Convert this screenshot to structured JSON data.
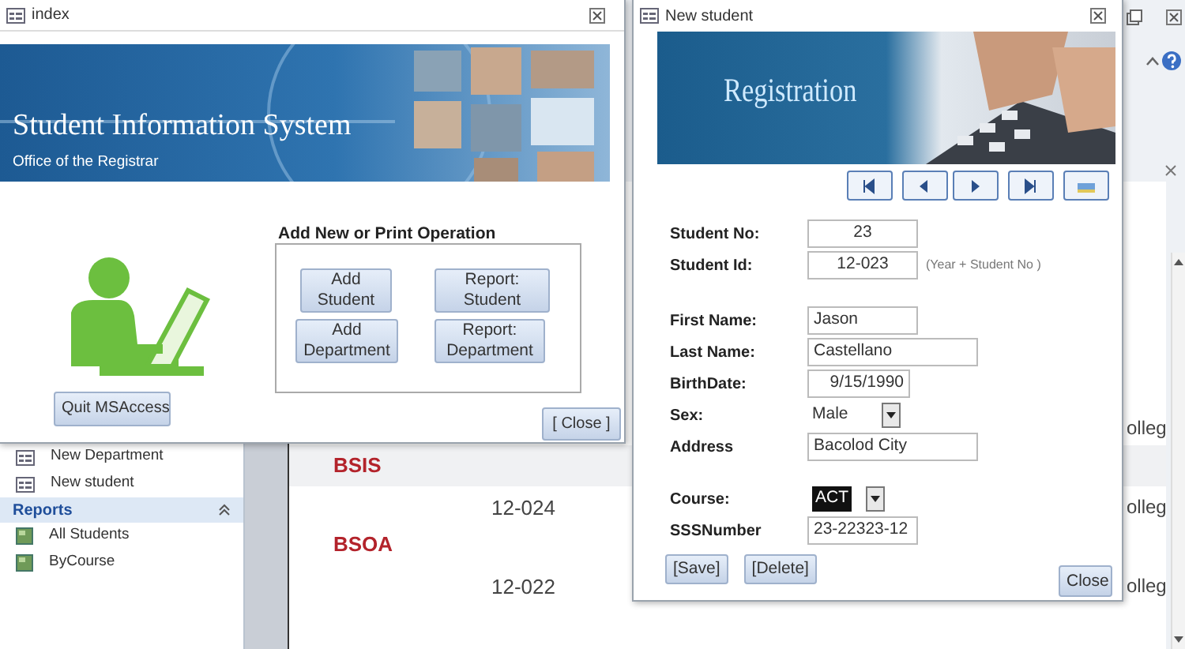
{
  "access": {
    "nav_items": [
      {
        "label": "New Department",
        "kind": "form"
      },
      {
        "label": "New student",
        "kind": "form"
      }
    ],
    "nav_group": {
      "label": "Reports",
      "expanded": true
    },
    "report_items": [
      {
        "label": "All Students",
        "kind": "report"
      },
      {
        "label": "ByCourse",
        "kind": "report"
      }
    ],
    "report_rows": [
      {
        "kind": "record",
        "college": "olleg"
      },
      {
        "kind": "group",
        "text": "BSIS"
      },
      {
        "kind": "record",
        "id": "12-024",
        "college": "olleg"
      },
      {
        "kind": "group",
        "text": "BSOA"
      },
      {
        "kind": "record",
        "id": "12-022",
        "college": "olleg"
      }
    ]
  },
  "index_window": {
    "title": "index",
    "banner": {
      "title": "Student Information System",
      "subtitle": "Office of the Registrar"
    },
    "quit_button": "Quit MSAccess",
    "group": {
      "title": "Add New or Print Operation",
      "buttons": [
        "Add Student",
        "Report: Student",
        "Add Department",
        "Report: Department"
      ]
    },
    "close_button": "[ Close ]"
  },
  "form_window": {
    "title": "New student",
    "banner_title": "Registration",
    "nav_buttons": [
      {
        "kind": "first"
      },
      {
        "kind": "previous"
      },
      {
        "kind": "next"
      },
      {
        "kind": "last"
      },
      {
        "kind": "new"
      }
    ],
    "fields": [
      {
        "label": "Student No:",
        "value": "23",
        "kind": "text",
        "highlighted": false
      },
      {
        "label": "Student Id:",
        "value": "12-023",
        "kind": "text",
        "highlighted": false,
        "hint": "(Year + Student No )"
      },
      {
        "label": "First Name:",
        "value": "Jason",
        "kind": "text",
        "highlighted": false
      },
      {
        "label": "Last Name:",
        "value": "Castellano",
        "kind": "text",
        "highlighted": false
      },
      {
        "label": "BirthDate:",
        "value": "9/15/1990",
        "kind": "text",
        "highlighted": false
      },
      {
        "label": "Sex:",
        "value": "Male",
        "kind": "select",
        "highlighted": false
      },
      {
        "label": "Address",
        "value": "Bacolod City",
        "kind": "text",
        "highlighted": false
      },
      {
        "label": "Course:",
        "value": "ACT",
        "kind": "select",
        "highlighted": true
      },
      {
        "label": "SSSNumber",
        "value": "23-22323-12",
        "kind": "text",
        "highlighted": false
      }
    ],
    "buttons": [
      "[Save]",
      "[Delete]"
    ],
    "close_button": "Close"
  }
}
